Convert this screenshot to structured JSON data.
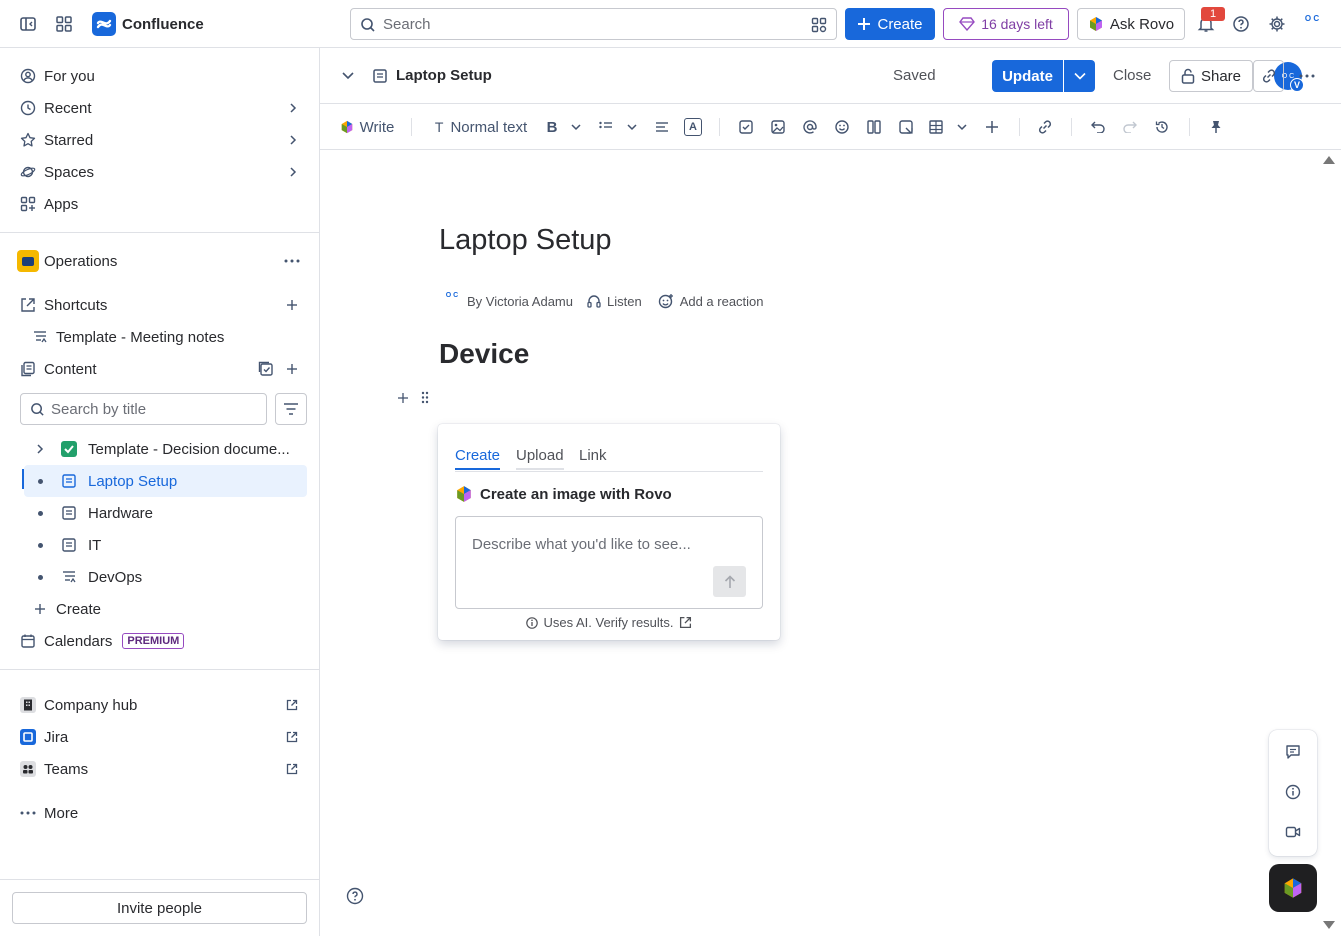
{
  "topbar": {
    "app_name": "Confluence",
    "search_placeholder": "Search",
    "create_label": "Create",
    "trial_label": "16 days left",
    "rovo_label": "Ask Rovo",
    "notification_count": "1",
    "avatar_initials": "O C"
  },
  "sidebar": {
    "nav": [
      {
        "label": "For you"
      },
      {
        "label": "Recent"
      },
      {
        "label": "Starred"
      },
      {
        "label": "Spaces"
      },
      {
        "label": "Apps"
      }
    ],
    "space_name": "Operations",
    "shortcuts_label": "Shortcuts",
    "shortcut_item": "Template - Meeting notes",
    "content_label": "Content",
    "search_placeholder": "Search by title",
    "tree": [
      {
        "label": "Template - Decision docume..."
      },
      {
        "label": "Laptop Setup"
      },
      {
        "label": "Hardware"
      },
      {
        "label": "IT"
      },
      {
        "label": "DevOps"
      }
    ],
    "create_label": "Create",
    "calendars_label": "Calendars",
    "premium_badge": "PREMIUM",
    "apps": [
      {
        "label": "Company hub"
      },
      {
        "label": "Jira"
      },
      {
        "label": "Teams"
      }
    ],
    "more_label": "More",
    "invite_label": "Invite people"
  },
  "page_header": {
    "title": "Laptop Setup",
    "saved_label": "Saved",
    "update_label": "Update",
    "close_label": "Close",
    "share_label": "Share",
    "avatar_initial": "V"
  },
  "toolbar": {
    "write_label": "Write",
    "text_style_label": "Normal text"
  },
  "document": {
    "title": "Laptop Setup",
    "author": "By Victoria Adamu",
    "listen_label": "Listen",
    "reaction_label": "Add a reaction",
    "heading": "Device"
  },
  "image_popup": {
    "tabs": [
      {
        "label": "Create"
      },
      {
        "label": "Upload"
      },
      {
        "label": "Link"
      }
    ],
    "heading": "Create an image with Rovo",
    "placeholder": "Describe what you'd like to see...",
    "footer": "Uses AI. Verify results."
  },
  "colors": {
    "brand": "#1868db",
    "trial_purple": "#964ac0",
    "active_bg": "#e9f2fe",
    "notification_red": "#e2483d"
  }
}
